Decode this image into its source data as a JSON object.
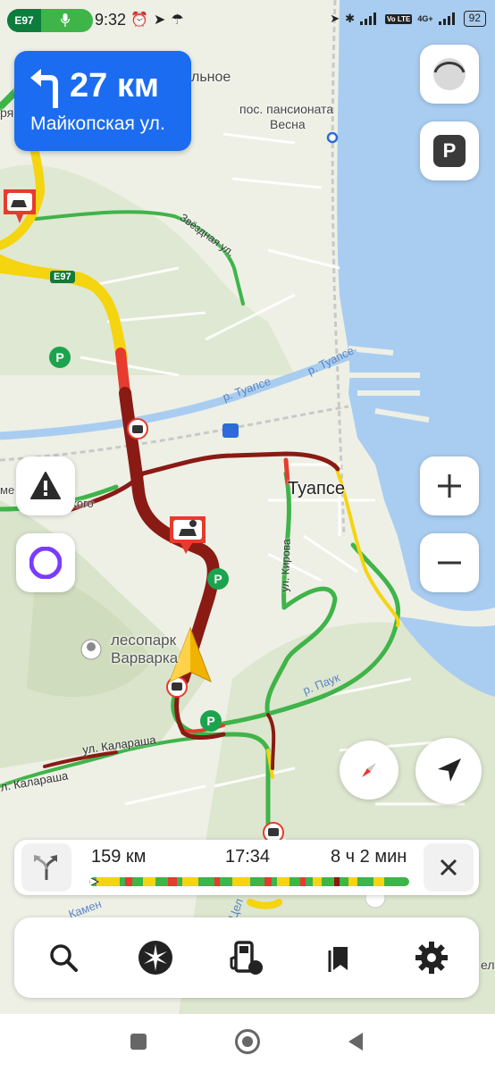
{
  "status_bar": {
    "route_tag": "E97",
    "time": "9:32",
    "network": "4G+",
    "volte": "Vo LTE",
    "battery": "92"
  },
  "maneuver": {
    "distance": "27 км",
    "street": "Майкопская ул."
  },
  "map_labels": {
    "village_top": "льное",
    "pension": "пос. пансионата",
    "pension2": "Весна",
    "left_edge": "ря",
    "zvezdnaya": "Звёздная ул.",
    "e97": "E97",
    "river1": "р. Туапсе",
    "river2": "р. Туапсе",
    "city": "Туапсе",
    "kirova": "ул. Кирова",
    "left_street": "ме",
    "left_street2": "кого",
    "park": "лесопарк",
    "park2": "Варварка",
    "pauk": "р. Паук",
    "kalarasha": "ул. Калараша",
    "kalarasha2": "л. Калараша",
    "kamen": "Камен",
    "cel": "Цел",
    "right_edge": "ел"
  },
  "route_info": {
    "distance": "159 км",
    "arrival": "17:34",
    "duration": "8 ч 2 мин"
  },
  "colors": {
    "primary": "#1b6cf0",
    "traffic_green": "#3fb449",
    "traffic_yellow": "#f5d410",
    "traffic_red": "#e63b2e",
    "traffic_darkred": "#8a1a14",
    "water": "#a9cdf0",
    "park_green": "#dfe8d2"
  },
  "icons": {
    "alice": "alice-icon",
    "parking": "parking-icon",
    "compass": "compass-icon"
  }
}
